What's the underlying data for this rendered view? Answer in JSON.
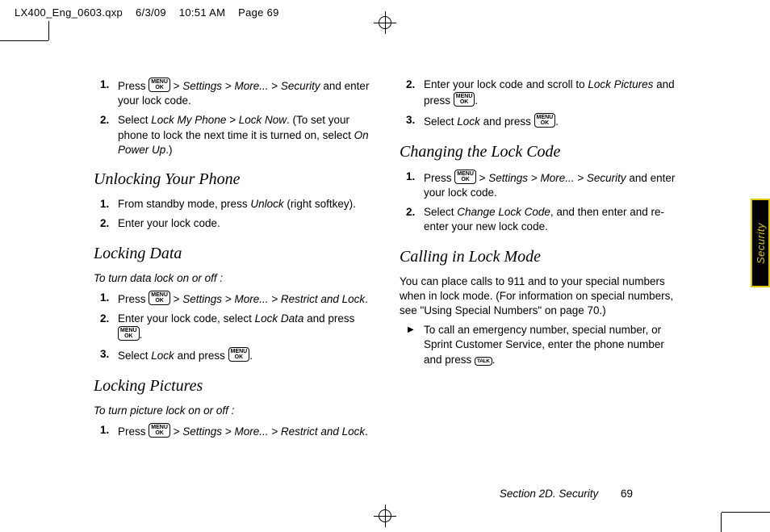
{
  "meta": {
    "file": "LX400_Eng_0603.qxp",
    "date": "6/3/09",
    "time": "10:51 AM",
    "page": "Page 69"
  },
  "keys": {
    "menu_ok": "MENU\nOK",
    "talk": "TALK"
  },
  "left": {
    "step1a": "Press ",
    "step1b": " > ",
    "step1_settings": "Settings",
    "step1_more": "More...",
    "step1_security": "Security",
    "step1c": " and enter your lock code.",
    "step2a": "Select ",
    "step2_lockmy": "Lock My Phone > Lock Now",
    "step2b": ". (To set your phone to lock the next time it is turned on, select ",
    "step2_onpower": "On Power Up",
    "step2c": ".)",
    "h_unlock": "Unlocking Your Phone",
    "u1a": "From standby mode, press ",
    "u1_unlock": "Unlock",
    "u1b": " (right softkey).",
    "u2": "Enter your lock code.",
    "h_ldata": "Locking Data",
    "ldata_lead": "To turn data lock on or off :",
    "ld1a": "Press ",
    "ld1_path": "Settings > More... > Restrict and Lock",
    "ld1b": ".",
    "ld2a": "Enter your lock code, select ",
    "ld2_lockdata": "Lock Data",
    "ld2b": " and press ",
    "ld2c": ".",
    "ld3a": "Select ",
    "ld3_lock": "Lock",
    "ld3b": " and press ",
    "ld3c": ".",
    "h_lpic": "Locking Pictures",
    "lpic_lead": "To turn picture lock on or off :",
    "lp1a": "Press ",
    "lp1_path": "Settings > More... > Restrict and Lock",
    "lp1b": "."
  },
  "right": {
    "r2a": "Enter your lock code and scroll to ",
    "r2_lockpic": "Lock Pictures",
    "r2b": " and press ",
    "r2c": ".",
    "r3a": "Select ",
    "r3_lock": "Lock",
    "r3b": " and press ",
    "r3c": ".",
    "h_change": "Changing the Lock Code",
    "c1a": "Press ",
    "c1_path": "Settings > More... > Security",
    "c1b": " and enter your lock code.",
    "c2a": "Select ",
    "c2_change": "Change Lock Code",
    "c2b": ", and then enter and re-enter your new lock code.",
    "h_call": "Calling in Lock Mode",
    "call_p": "You can place calls to 911 and to your special numbers when in lock mode. (For information on special numbers, see \"Using Special Numbers\" on page 70.)",
    "call_b1a": "To call an emergency number, special number, or Sprint Customer Service, enter the phone number and press ",
    "call_b1b": "."
  },
  "footer": {
    "section": "Section 2D. Security",
    "page": "69"
  },
  "tab": "Security"
}
